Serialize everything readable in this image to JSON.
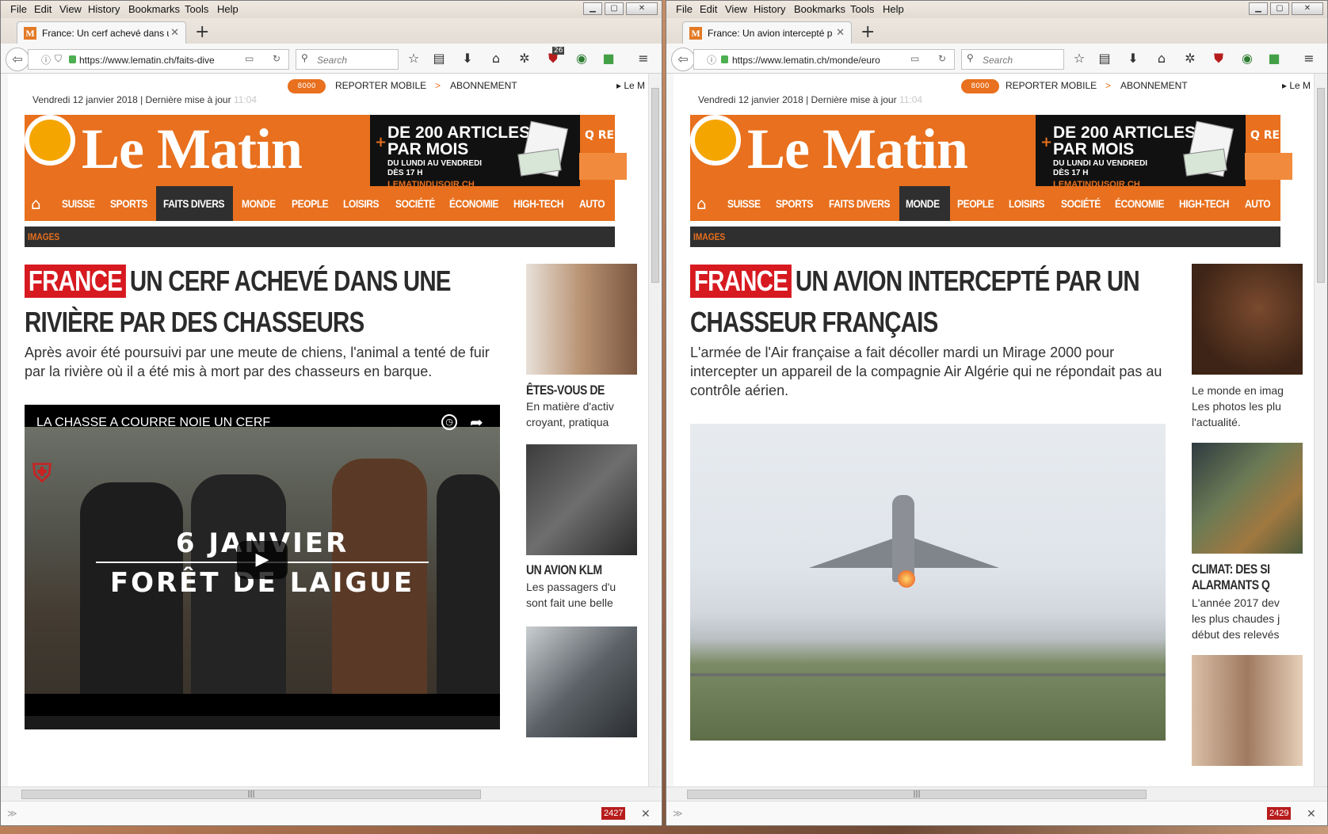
{
  "menu": [
    "File",
    "Edit",
    "View",
    "History",
    "Bookmarks",
    "Tools",
    "Help"
  ],
  "windows": [
    {
      "tab_title": "France: Un cerf achevé dans u",
      "url": "https://www.lematin.ch/faits-dive",
      "search_placeholder": "Search",
      "addon_badge": "26",
      "status_count": "2427",
      "top_links": {
        "pill": "8000",
        "reporter": "REPORTER MOBILE",
        "sep": ">",
        "abonnement": "ABONNEMENT",
        "lem": "▸ Le M"
      },
      "date": "Vendredi 12 janvier 2018 | Dernière mise à jour",
      "update_time": "11:04",
      "logo": "Le Matin",
      "ad": {
        "line1": "DE 200 ARTICLES",
        "line2": "PAR MOIS",
        "line3": "DU LUNDI AU VENDREDI",
        "line4": "DÈS 17 H",
        "line5": "LEMATINDUSOIR.CH"
      },
      "search_label": "Q RE",
      "nav": [
        "SUISSE",
        "SPORTS",
        "FAITS DIVERS",
        "MONDE",
        "PEOPLE",
        "LOISIRS",
        "SOCIÉTÉ",
        "ÉCONOMIE",
        "HIGH-TECH",
        "AUTO"
      ],
      "nav_active": "FAITS DIVERS",
      "subnav": "IMAGES",
      "kicker": "FRANCE",
      "headline": "UN CERF ACHEVÉ DANS UNE RIVIÈRE PAR DES CHASSEURS",
      "lead": "Après avoir été poursuivi par une meute de chiens, l'animal a tenté de fuir par la rivière où il a été mis à mort par des chasseurs en barque.",
      "video": {
        "title": "LA CHASSE A COURRE NOIE UN CERF",
        "line1": "6 JANVIER",
        "line2": "FORÊT DE LAIGUE"
      },
      "sidebar": [
        {
          "title": "ÊTES-VOUS DE",
          "desc1": "En matière d'activ",
          "desc2": "croyant, pratiqua"
        },
        {
          "title": "UN AVION KLM",
          "desc1": "Les passagers d'u",
          "desc2": "sont fait une belle"
        }
      ]
    },
    {
      "tab_title": "France: Un avion intercepté p",
      "url": "https://www.lematin.ch/monde/euro",
      "search_placeholder": "Search",
      "status_count": "2429",
      "top_links": {
        "pill": "8000",
        "reporter": "REPORTER MOBILE",
        "sep": ">",
        "abonnement": "ABONNEMENT",
        "lem": "▸ Le M"
      },
      "date": "Vendredi 12 janvier 2018 | Dernière mise à jour",
      "update_time": "11:04",
      "logo": "Le Matin",
      "ad": {
        "line1": "DE 200 ARTICLES",
        "line2": "PAR MOIS",
        "line3": "DU LUNDI AU VENDREDI",
        "line4": "DÈS 17 H",
        "line5": "LEMATINDUSOIR.CH"
      },
      "search_label": "Q RE",
      "nav": [
        "SUISSE",
        "SPORTS",
        "FAITS DIVERS",
        "MONDE",
        "PEOPLE",
        "LOISIRS",
        "SOCIÉTÉ",
        "ÉCONOMIE",
        "HIGH-TECH",
        "AUTO"
      ],
      "nav_active": "MONDE",
      "subnav": "IMAGES",
      "kicker": "FRANCE",
      "headline": "UN AVION INTERCEPTÉ PAR UN CHASSEUR FRANÇAIS",
      "lead": "L'armée de l'Air française a fait décoller mardi un Mirage 2000 pour intercepter un appareil de la compagnie Air Algérie qui ne répondait pas au contrôle aérien.",
      "sidebar": [
        {
          "desc1": "Le monde en imag",
          "desc2": "Les photos les plu",
          "desc3": "l'actualité."
        },
        {
          "title": "CLIMAT: DES SI",
          "title2": "ALARMANTS Q",
          "desc1": "L'année 2017 dev",
          "desc2": "les plus chaudes j",
          "desc3": "début des relevés"
        }
      ]
    }
  ],
  "colors": {
    "brand": "#e8701e",
    "kicker": "#d71920",
    "dark": "#2f2f2f",
    "logo_dot": "#f5a500"
  }
}
